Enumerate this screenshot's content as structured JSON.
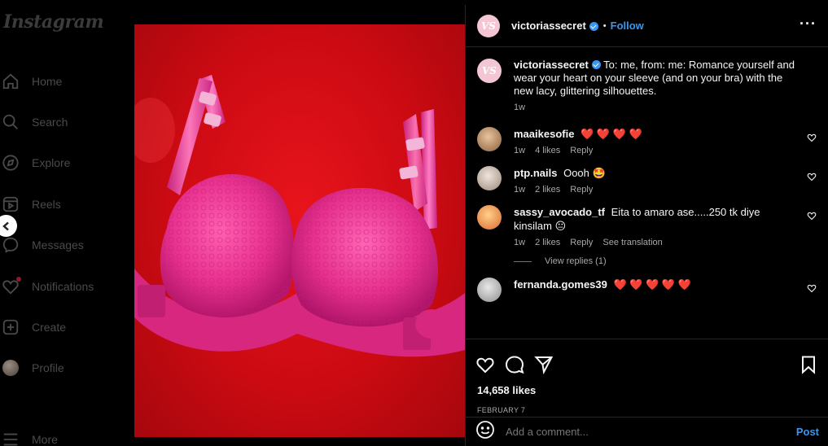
{
  "app": {
    "logo": "Instagram"
  },
  "sidebar": {
    "items": [
      {
        "label": "Home",
        "icon": "home-icon"
      },
      {
        "label": "Search",
        "icon": "search-icon"
      },
      {
        "label": "Explore",
        "icon": "compass-icon"
      },
      {
        "label": "Reels",
        "icon": "reels-icon"
      },
      {
        "label": "Messages",
        "icon": "messenger-icon"
      },
      {
        "label": "Notifications",
        "icon": "heart-icon"
      },
      {
        "label": "Create",
        "icon": "plus-square-icon"
      },
      {
        "label": "Profile",
        "icon": "avatar"
      },
      {
        "label": "More",
        "icon": "menu-icon"
      }
    ]
  },
  "post": {
    "author": "victoriassecret",
    "avatar_text": "VS",
    "follow_label": "Follow",
    "dot": "•",
    "caption": "To: me, from: me: Romance yourself and wear your heart on your sleeve (and on your bra) with the new lacy, glittering silhouettes.",
    "caption_age": "1w",
    "likes": "14,658 likes",
    "date": "FEBRUARY 7",
    "add_comment_placeholder": "Add a comment...",
    "post_label": "Post",
    "image_description": "pink lace bra on red background"
  },
  "comments": [
    {
      "user": "maaikesofie",
      "text": "❤️ ❤️ ❤️ ❤️",
      "age": "1w",
      "likes": "4 likes",
      "reply": "Reply",
      "avatar_color": "#c9a07a"
    },
    {
      "user": "ptp.nails",
      "text": "Oooh 🤩",
      "age": "1w",
      "likes": "2 likes",
      "reply": "Reply",
      "avatar_color": "#c7b9ad"
    },
    {
      "user": "sassy_avocado_tf",
      "text": "Eita to amaro ase.....250 tk diye kinsilam 😐",
      "age": "1w",
      "likes": "2 likes",
      "reply": "Reply",
      "see_translation": "See translation",
      "view_replies": "View replies (1)",
      "avatar_color": "#e8a15a"
    },
    {
      "user": "fernanda.gomes39",
      "text": "❤️ ❤️ ❤️ ❤️ ❤️",
      "avatar_color": "#bdbdbd"
    }
  ],
  "colors": {
    "accent": "#3897f0",
    "background": "#000000",
    "image_red": "#d40e16",
    "bra_pink": "#e8318f"
  }
}
